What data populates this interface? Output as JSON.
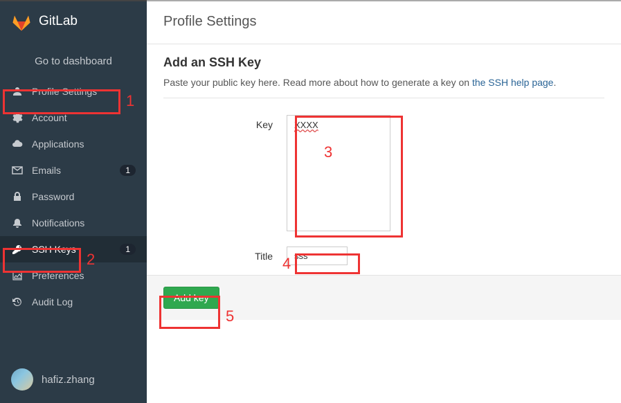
{
  "brand": {
    "name": "GitLab"
  },
  "sidebar": {
    "dashboard_label": "Go to dashboard",
    "items": [
      {
        "label": "Profile Settings"
      },
      {
        "label": "Account"
      },
      {
        "label": "Applications"
      },
      {
        "label": "Emails",
        "badge": "1"
      },
      {
        "label": "Password"
      },
      {
        "label": "Notifications"
      },
      {
        "label": "SSH Keys",
        "badge": "1"
      },
      {
        "label": "Preferences"
      },
      {
        "label": "Audit Log"
      }
    ]
  },
  "user": {
    "name": "hafiz.zhang"
  },
  "page": {
    "title": "Profile Settings",
    "section_heading": "Add an SSH Key",
    "section_desc_pre": "Paste your public key here. Read more about how to generate a key on ",
    "section_desc_link": "the SSH help page",
    "section_desc_post": "."
  },
  "form": {
    "key_label": "Key",
    "key_value": "XXXX",
    "title_label": "Title",
    "title_value": "sss",
    "submit_label": "Add key"
  },
  "annotations": {
    "n1": "1",
    "n2": "2",
    "n3": "3",
    "n4": "4",
    "n5": "5"
  }
}
